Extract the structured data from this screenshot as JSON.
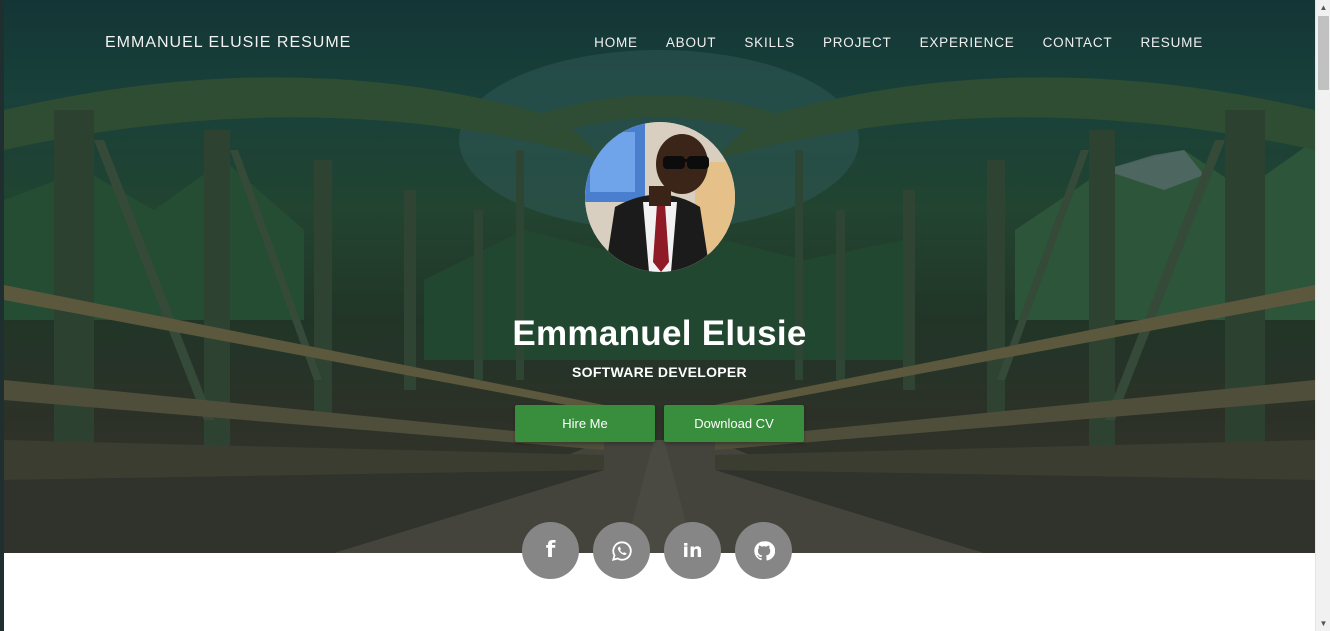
{
  "header": {
    "brand": "EMMANUEL ELUSIE RESUME",
    "nav": [
      "HOME",
      "ABOUT",
      "SKILLS",
      "PROJECT",
      "EXPERIENCE",
      "CONTACT",
      "RESUME"
    ]
  },
  "hero": {
    "name": "Emmanuel Elusie",
    "role": "SOFTWARE DEVELOPER",
    "hire_label": "Hire Me",
    "cv_label": "Download CV"
  },
  "social": [
    {
      "icon": "facebook-icon"
    },
    {
      "icon": "whatsapp-icon"
    },
    {
      "icon": "linkedin-icon"
    },
    {
      "icon": "github-icon"
    }
  ],
  "colors": {
    "button_green": "#388e3c",
    "social_gray": "#868686",
    "overlay": "#173a3a"
  }
}
